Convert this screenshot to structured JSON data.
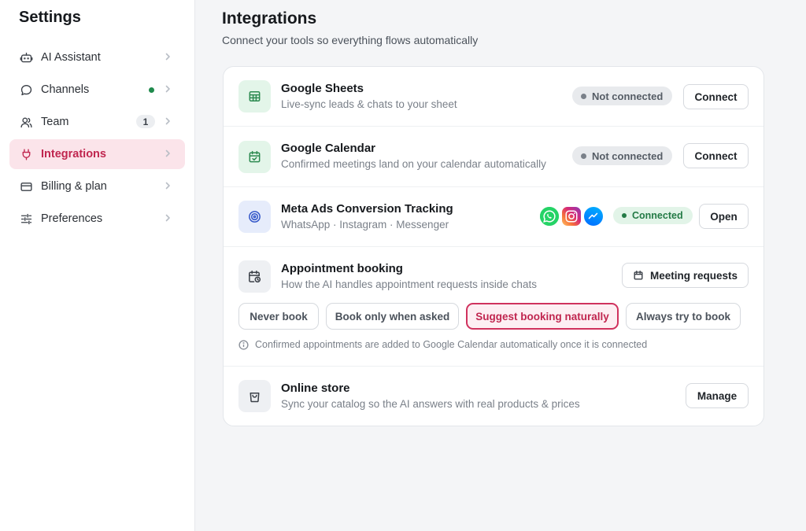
{
  "sidebar": {
    "title": "Settings",
    "items": [
      {
        "label": "AI Assistant"
      },
      {
        "label": "Channels"
      },
      {
        "label": "Team",
        "count": "1"
      },
      {
        "label": "Integrations"
      },
      {
        "label": "Billing & plan"
      },
      {
        "label": "Preferences"
      }
    ],
    "active_color": "#c0264f",
    "channel_status_color": "#1f8a4c"
  },
  "header": {
    "title": "Integrations",
    "subtitle": "Connect your tools so everything flows automatically"
  },
  "integrations": {
    "google_sheets": {
      "title": "Google Sheets",
      "description": "Live-sync leads & chats to your sheet",
      "status": "Not connected",
      "action": "Connect"
    },
    "google_calendar": {
      "title": "Google Calendar",
      "description": "Confirmed meetings land on your calendar automatically",
      "status": "Not connected",
      "action": "Connect"
    },
    "meta_ads": {
      "title": "Meta Ads Conversion Tracking",
      "description": "WhatsApp · Instagram · Messenger",
      "status": "Connected",
      "action": "Open",
      "icons": [
        "whatsapp-icon",
        "instagram-icon",
        "messenger-icon"
      ]
    },
    "appointment_booking": {
      "title": "Appointment booking",
      "description": "How the AI handles appointment requests inside chats",
      "action": "Meeting requests",
      "options": [
        "Never book",
        "Book only when asked",
        "Suggest booking naturally",
        "Always try to book"
      ],
      "selected": "Suggest booking naturally",
      "note": "Confirmed appointments are added to Google Calendar automatically once it is connected"
    },
    "online_store": {
      "title": "Online store",
      "description": "Sync your catalog so the AI answers with real products & prices",
      "action": "Manage"
    }
  }
}
